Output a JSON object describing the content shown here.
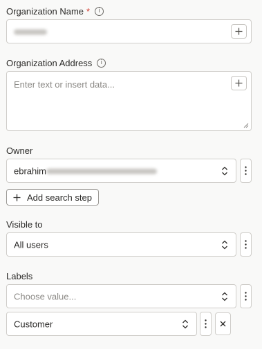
{
  "org_name": {
    "label": "Organization Name",
    "required_mark": "*",
    "value_obscured": true
  },
  "org_address": {
    "label": "Organization Address",
    "placeholder": "Enter text or insert data..."
  },
  "owner": {
    "label": "Owner",
    "value_prefix": "ebrahim",
    "value_rest_obscured": true
  },
  "add_search_step": {
    "label": "Add search step"
  },
  "visible_to": {
    "label": "Visible to",
    "value": "All users"
  },
  "labels": {
    "label": "Labels",
    "placeholder": "Choose value...",
    "selected": "Customer"
  },
  "icons": {
    "info": "info-icon",
    "plus": "plus-icon",
    "chevron": "chevron-updown-icon",
    "kebab": "kebab-icon",
    "close": "close-icon",
    "resize": "resize-handle-icon"
  },
  "colors": {
    "required": "#d23b2f",
    "border": "#cfcdc9",
    "background": "#f9f9f8"
  }
}
